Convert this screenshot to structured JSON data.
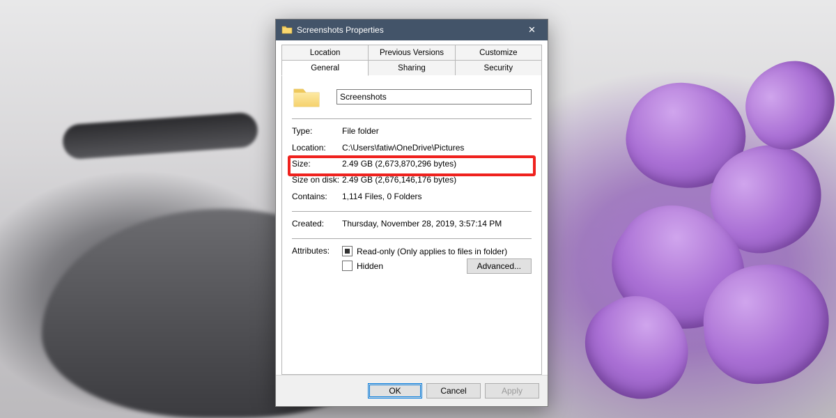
{
  "window": {
    "title": "Screenshots Properties",
    "close_icon": "✕"
  },
  "tabs": {
    "row1": [
      "Location",
      "Previous Versions",
      "Customize"
    ],
    "row2": [
      "General",
      "Sharing",
      "Security"
    ],
    "active": "General"
  },
  "general": {
    "folder_name": "Screenshots",
    "type_label": "Type:",
    "type_value": "File folder",
    "location_label": "Location:",
    "location_value": "C:\\Users\\fatiw\\OneDrive\\Pictures",
    "size_label": "Size:",
    "size_value": "2.49 GB (2,673,870,296 bytes)",
    "size_on_disk_label": "Size on disk:",
    "size_on_disk_value": "2.49 GB (2,676,146,176 bytes)",
    "contains_label": "Contains:",
    "contains_value": "1,114 Files, 0 Folders",
    "created_label": "Created:",
    "created_value": "Thursday, November 28, 2019, 3:57:14 PM",
    "attributes_label": "Attributes:",
    "readonly_label": "Read-only (Only applies to files in folder)",
    "hidden_label": "Hidden",
    "advanced_label": "Advanced..."
  },
  "footer": {
    "ok": "OK",
    "cancel": "Cancel",
    "apply": "Apply"
  }
}
